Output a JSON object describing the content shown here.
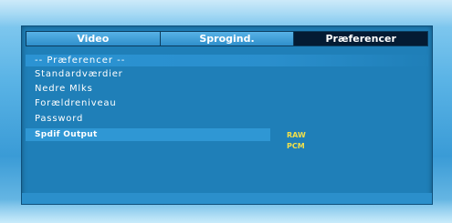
{
  "tabs": [
    {
      "label": "Video",
      "active": false
    },
    {
      "label": "Sprogind.",
      "active": false
    },
    {
      "label": "Præferencer",
      "active": true
    }
  ],
  "section_title": "-- Præferencer --",
  "menu_items": [
    "Standardværdier",
    "Nedre Mlks",
    "Forældreniveau",
    "Password",
    "Spdif Output"
  ],
  "spdif_options": [
    "RAW",
    "PCM"
  ],
  "colors": {
    "panel": "#1f7fb8",
    "active_tab": "#041b33",
    "highlight": "#2f97d4",
    "option_text": "#f2e04a"
  }
}
